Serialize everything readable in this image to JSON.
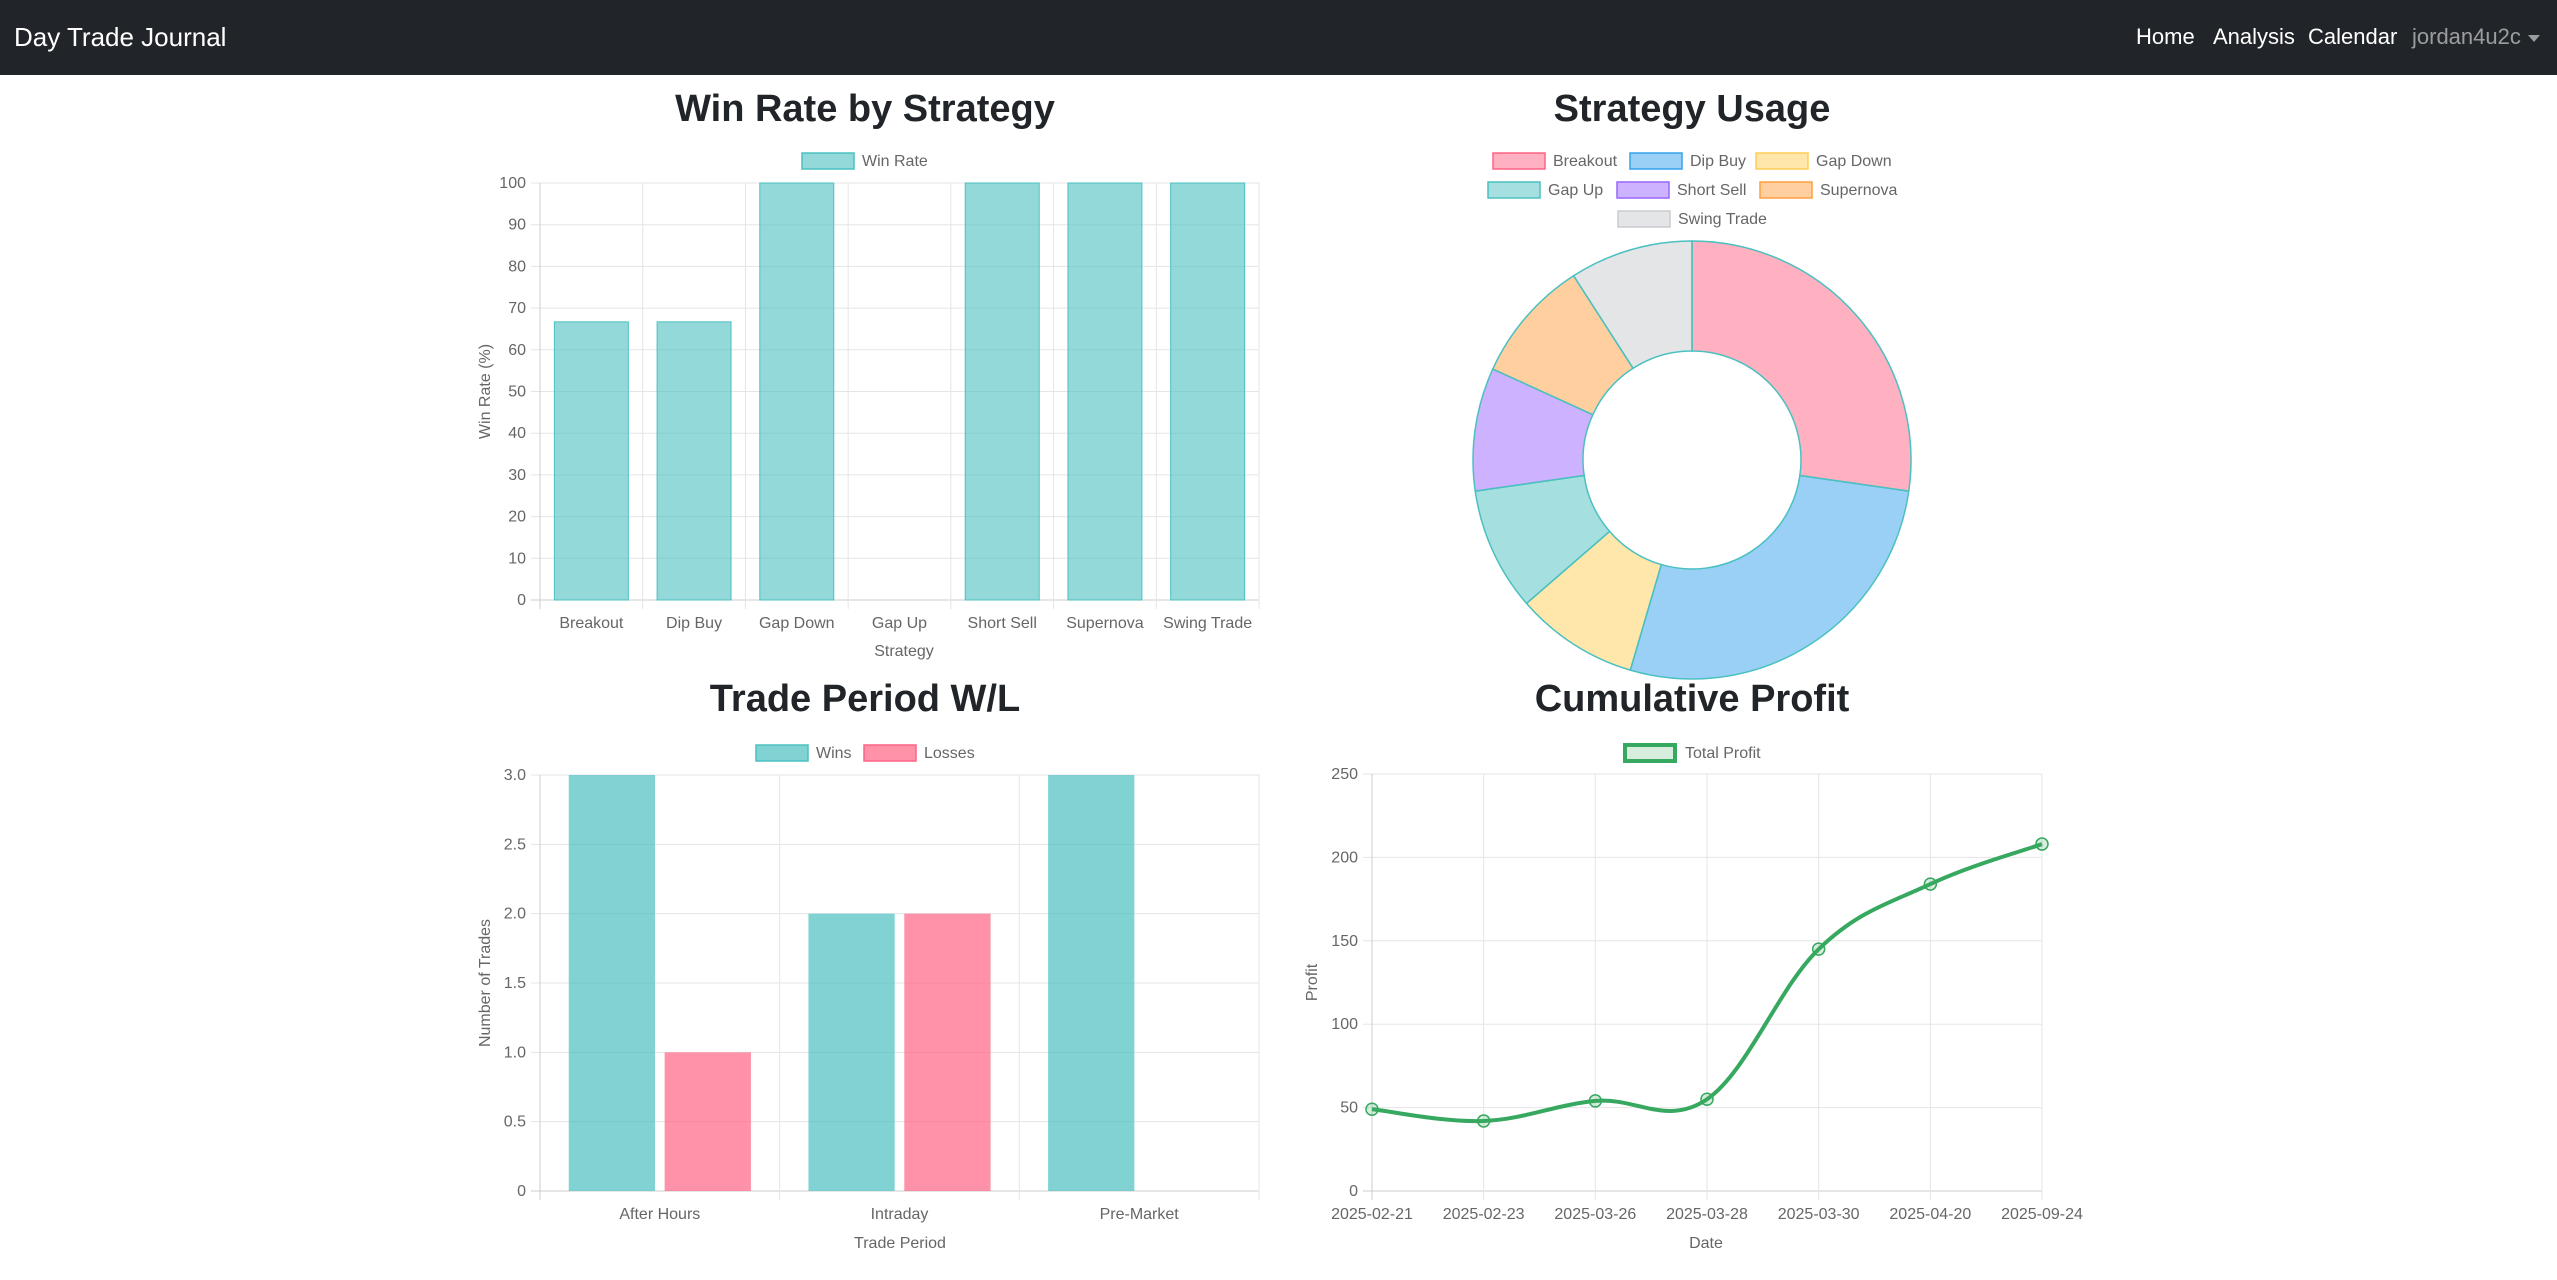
{
  "navbar": {
    "brand": "Day Trade Journal",
    "links": [
      "Home",
      "Analysis",
      "Calendar"
    ],
    "user": "jordan4u2c"
  },
  "colors": {
    "teal": "#4bc0c0",
    "pink": "#ff6384",
    "blue": "#36a2eb",
    "yellow": "#ffcd56",
    "purple": "#9966ff",
    "orange": "#ff9f40",
    "gray": "#c9cbcf",
    "green": "#36a85f",
    "navbar": "#212529"
  },
  "chart_data": [
    {
      "type": "bar",
      "title": "Win Rate by Strategy",
      "categories": [
        "Breakout",
        "Dip Buy",
        "Gap Down",
        "Gap Up",
        "Short Sell",
        "Supernova",
        "Swing Trade"
      ],
      "series": [
        {
          "name": "Win Rate",
          "values": [
            66.7,
            66.7,
            100,
            0,
            100,
            100,
            100
          ]
        }
      ],
      "xlabel": "Strategy",
      "ylabel": "Win Rate (%)",
      "ylim": [
        0,
        100
      ],
      "yticks": [
        "0",
        "10",
        "20",
        "30",
        "40",
        "50",
        "60",
        "70",
        "80",
        "90",
        "100"
      ],
      "grid": true,
      "legend": "top"
    },
    {
      "type": "pie",
      "title": "Strategy Usage",
      "labels": [
        "Breakout",
        "Dip Buy",
        "Gap Down",
        "Gap Up",
        "Short Sell",
        "Supernova",
        "Swing Trade"
      ],
      "values": [
        3,
        3,
        1,
        1,
        1,
        1,
        1
      ],
      "legend": "top"
    },
    {
      "type": "bar",
      "title": "Trade Period W/L",
      "categories": [
        "After Hours",
        "Intraday",
        "Pre-Market"
      ],
      "series": [
        {
          "name": "Wins",
          "values": [
            3,
            2,
            3
          ]
        },
        {
          "name": "Losses",
          "values": [
            1,
            2,
            0
          ]
        }
      ],
      "xlabel": "Trade Period",
      "ylabel": "Number of Trades",
      "ylim": [
        0,
        3
      ],
      "yticks": [
        "0",
        "0.5",
        "1.0",
        "1.5",
        "2.0",
        "2.5",
        "3.0"
      ],
      "grid": true,
      "legend": "top"
    },
    {
      "type": "line",
      "title": "Cumulative Profit",
      "x": [
        "2025-02-21",
        "2025-02-23",
        "2025-03-26",
        "2025-03-28",
        "2025-03-30",
        "2025-04-20",
        "2025-09-24"
      ],
      "series": [
        {
          "name": "Total Profit",
          "values": [
            49,
            42,
            54,
            55,
            145,
            184,
            208
          ]
        }
      ],
      "xlabel": "Date",
      "ylabel": "Profit",
      "ylim": [
        0,
        250
      ],
      "yticks": [
        "0",
        "50",
        "100",
        "150",
        "200",
        "250"
      ],
      "grid": true,
      "legend": "top"
    }
  ]
}
